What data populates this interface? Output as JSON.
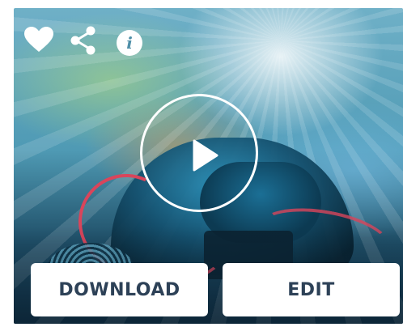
{
  "card": {
    "actions": {
      "favorite_icon": "heart-icon",
      "share_icon": "share-icon",
      "info_icon": "info-icon",
      "info_glyph": "i"
    },
    "media": {
      "play_icon": "play-icon"
    },
    "buttons": {
      "download_label": "DOWNLOAD",
      "edit_label": "EDIT"
    }
  },
  "colors": {
    "button_text": "#2d4157",
    "button_bg": "#ffffff",
    "icon": "#ffffff"
  }
}
